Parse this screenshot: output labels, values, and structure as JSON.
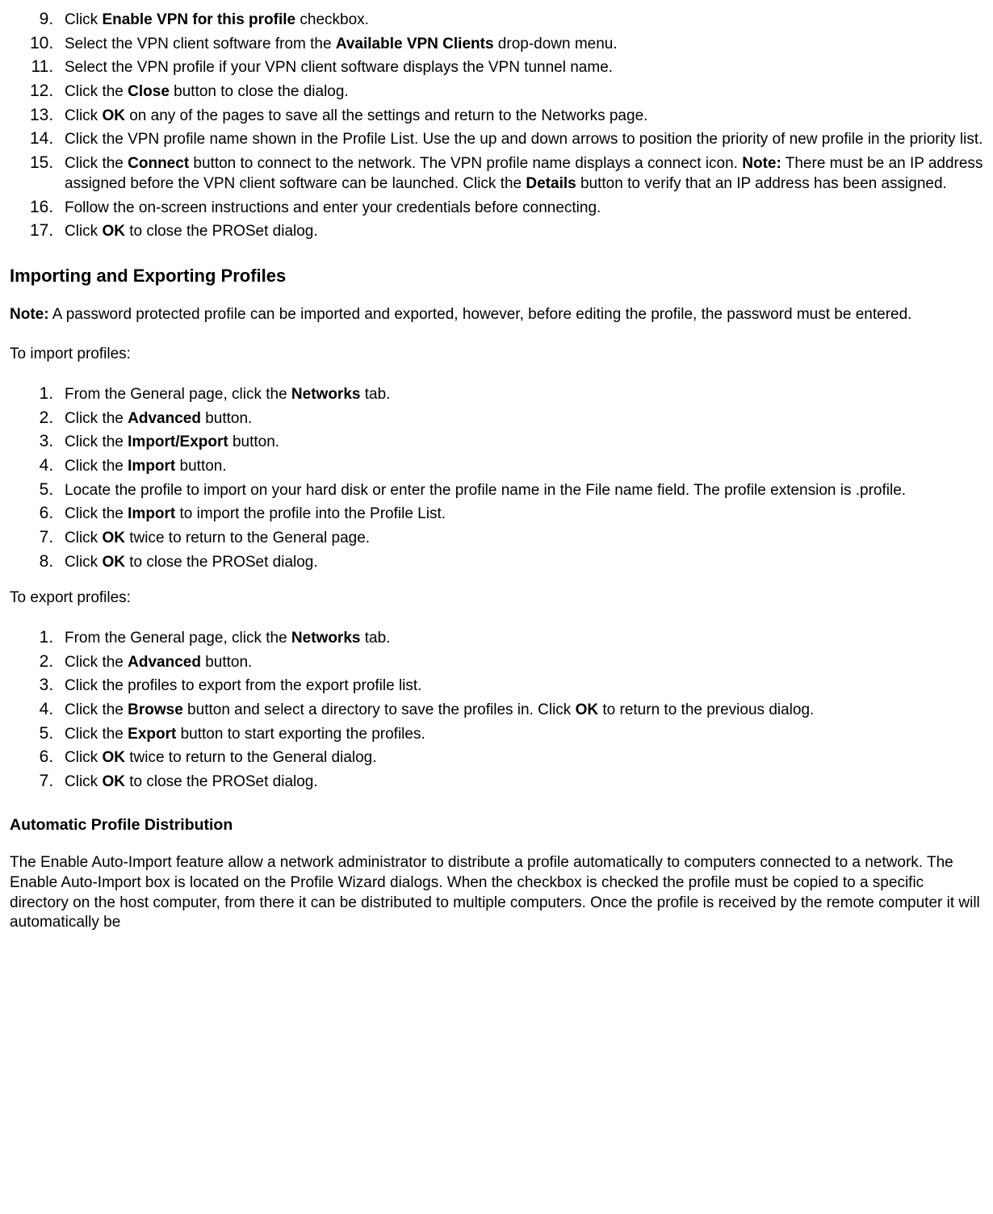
{
  "list1_start": 9,
  "list1": [
    "Click <b>Enable VPN for this profile</b> checkbox.",
    "Select the VPN client software from the <b>Available VPN Clients</b> drop-down menu.",
    "Select the VPN profile if your VPN client software displays the VPN tunnel name.",
    "Click the <b>Close</b> button to close the dialog.",
    "Click <b>OK</b> on any of the pages to save all the settings and return to the Networks page.",
    "Click the VPN profile name shown in the Profile List. Use the up and down arrows to position the priority of new profile in the priority list.",
    "Click the <b>Connect</b> button to connect to the network. The VPN profile name displays a connect icon. <b>Note:</b> There must be an IP address assigned before the VPN client software can be launched. Click the <b>Details</b> button to verify that an IP address has been assigned.",
    "Follow the on-screen instructions and enter your credentials before connecting.",
    "Click <b>OK</b> to close the PROSet dialog."
  ],
  "heading_import_export": "Importing and Exporting Profiles",
  "note_import_export": "<b>Note:</b> A password protected profile can be imported and exported, however, before editing the profile, the password must be entered.",
  "to_import": "To import profiles:",
  "list_import": [
    "From the General page, click the <b>Networks</b> tab.",
    "Click the <b>Advanced</b> button.",
    "Click the <b>Import/Export</b> button.",
    "Click the <b>Import</b> button.",
    "Locate the profile to import on your hard disk or enter the profile name in the File name field. The profile extension is .profile.",
    "Click the <b>Import</b> to import the profile into the Profile List.",
    "Click <b>OK</b> twice to return to the General page.",
    "Click <b>OK</b> to close the PROSet dialog."
  ],
  "to_export": "To export profiles:",
  "list_export": [
    "From the General page, click the <b>Networks</b> tab.",
    "Click the <b>Advanced</b> button.",
    "Click the profiles to export from the export profile list.",
    "Click the <b>Browse</b> button and select a directory to save the profiles in. Click <b>OK</b> to return to the previous dialog.",
    "Click the <b>Export</b> button to start exporting the profiles.",
    "Click <b>OK</b> twice to return to the General dialog.",
    "Click <b>OK</b> to close the PROSet dialog."
  ],
  "heading_auto": "Automatic Profile Distribution",
  "auto_para": "The Enable Auto-Import feature allow a network administrator to distribute a profile automatically to computers connected to a network. The Enable Auto-Import box is located on the Profile Wizard dialogs. When the checkbox is checked the profile must be copied to a specific directory on the host computer, from there it can be distributed to multiple computers. Once the profile is received by the remote computer it will automatically be"
}
